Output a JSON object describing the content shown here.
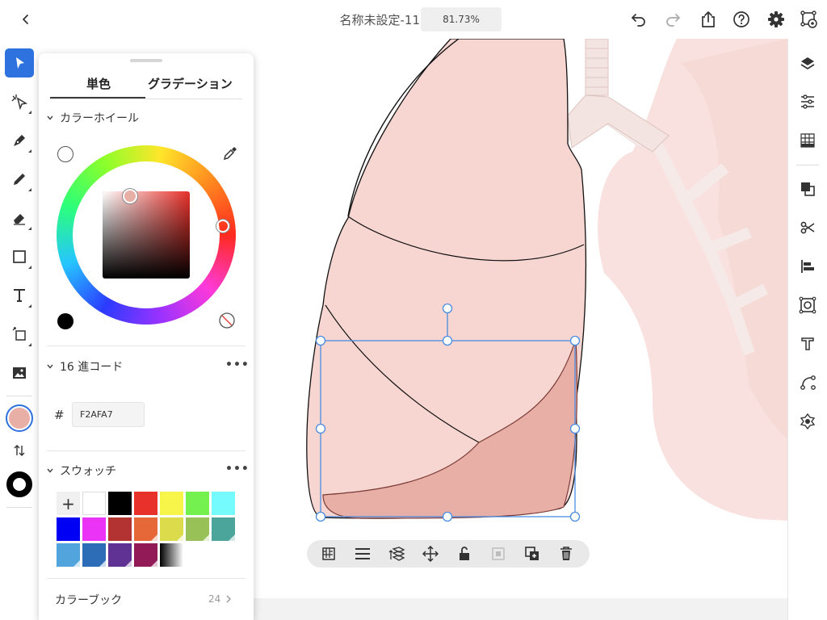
{
  "header": {
    "doc_title": "名称未設定-11",
    "zoom": "81.73%"
  },
  "tools": {
    "fill_color": "#E8AFA7",
    "stroke_color": "#000000",
    "accent": "#2E72DF"
  },
  "color_panel": {
    "tabs": [
      "単色",
      "グラデーション"
    ],
    "active_tab": "単色",
    "wheel": {
      "title": "カラーホイール",
      "hue_color": "#E8302A"
    },
    "hex": {
      "title": "16 進コード",
      "more": "•••",
      "hash": "#",
      "value": "F2AFA7"
    },
    "swatches": {
      "title": "スウォッチ",
      "more": "•••",
      "add_label": "+",
      "colors": [
        "#FFFFFF",
        "#000000",
        "#E8312A",
        "#F7F54A",
        "#74F14E",
        "#75FBFD",
        "#0000F5",
        "#EA33F7",
        "#B23332",
        "#E66838",
        "#DBDB4B",
        "#98C158",
        "#4BA59A",
        "#52A4DC",
        "#2D6CB6",
        "#5F3293",
        "#921B57"
      ]
    },
    "color_book": {
      "label": "カラーブック",
      "count": "24"
    }
  },
  "icons": {
    "back": "chevron-left-icon",
    "undo": "undo-icon",
    "redo": "redo-icon",
    "share": "share-icon",
    "help": "help-icon",
    "settings": "gear-icon",
    "preview": "preview-icon"
  }
}
